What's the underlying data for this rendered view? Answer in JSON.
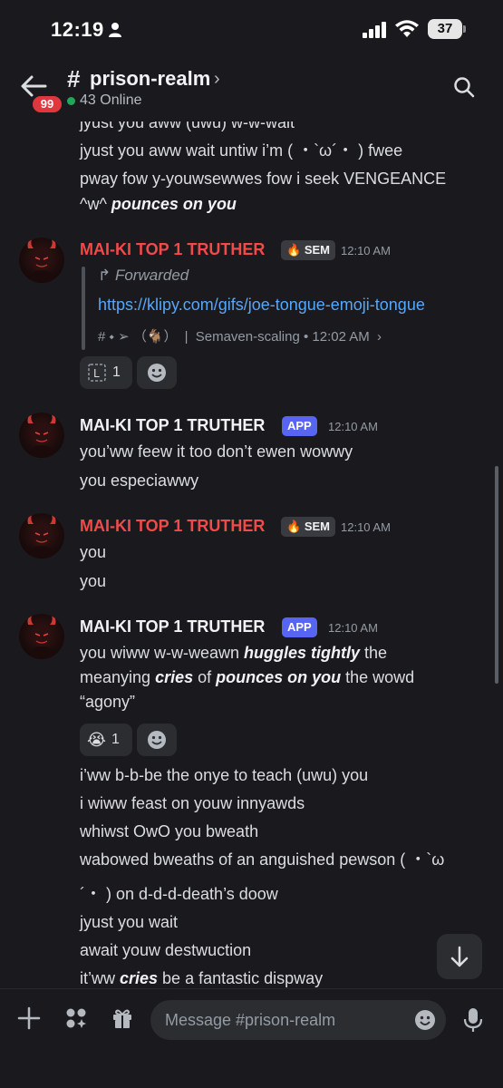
{
  "status": {
    "time": "12:19",
    "battery": "37"
  },
  "header": {
    "back_badge": "99",
    "hash": "#",
    "title": "prison-realm",
    "chevron": "›",
    "online": "43 Online"
  },
  "top_lines": [
    "jyust you aww (uwu) w-w-wait",
    "jyust you aww wait untiw i’m ( ・`ω´・ ) fwee",
    "pway fow y-youwsewwes fow i seek VENGEANCE",
    "^w^",
    "pounces on you"
  ],
  "msg1": {
    "author": "MAI-KI TOP 1 TRUTHER",
    "tag": "SEM",
    "time": "12:10 AM",
    "forwarded": "Forwarded",
    "link": "https://klipy.com/gifs/joe-tongue-emoji-tongue",
    "source_prefix": "# ⬩ ➢ （🐐）",
    "source_sep": "|",
    "source_channel": "Semaven-scaling",
    "source_time": "• 12:02 AM",
    "source_chev": "›",
    "reaction_count": "1"
  },
  "msg2": {
    "author": "MAI-KI TOP 1 TRUTHER",
    "tag": "APP",
    "time": "12:10 AM",
    "lines": [
      "you’ww feew it too don’t ewen wowwy",
      "you especiawwy"
    ]
  },
  "msg3": {
    "author": "MAI-KI TOP 1 TRUTHER",
    "tag": "SEM",
    "time": "12:10 AM",
    "lines": [
      "you",
      "you"
    ]
  },
  "msg4": {
    "author": "MAI-KI TOP 1 TRUTHER",
    "tag": "APP",
    "time": "12:10 AM",
    "line1_a": "you wiww w-w-weawn ",
    "line1_b": "huggles tightly",
    "line1_c": " the",
    "line2_a": "meanying ",
    "line2_b": "cries",
    "line2_c": " of ",
    "line2_d": "pounces on you",
    "line2_e": " the wowd",
    "line3": "“agony”",
    "reaction_emoji": "😭",
    "reaction_count": "1",
    "more_lines": [
      "i’ww b-b-be the onye to teach (uwu) you",
      "i wiww feast on youw innyawds",
      "whiwst OwO you bweath",
      "wabowed bweaths of an anguished pewson ( ・`ω",
      "´・ ) on d-d-d-death’s doow",
      "jyust you wait",
      "await youw destwuction"
    ],
    "last_a": "it’ww ",
    "last_b": "cries",
    "last_c": " be a fantastic dispway"
  },
  "composer": {
    "placeholder": "Message #prison-realm"
  },
  "colors": {
    "author_red": "#f04a4a",
    "app_tag": "#5865f2",
    "link": "#58a6f7",
    "online": "#23a55a",
    "badge": "#e0373f"
  }
}
